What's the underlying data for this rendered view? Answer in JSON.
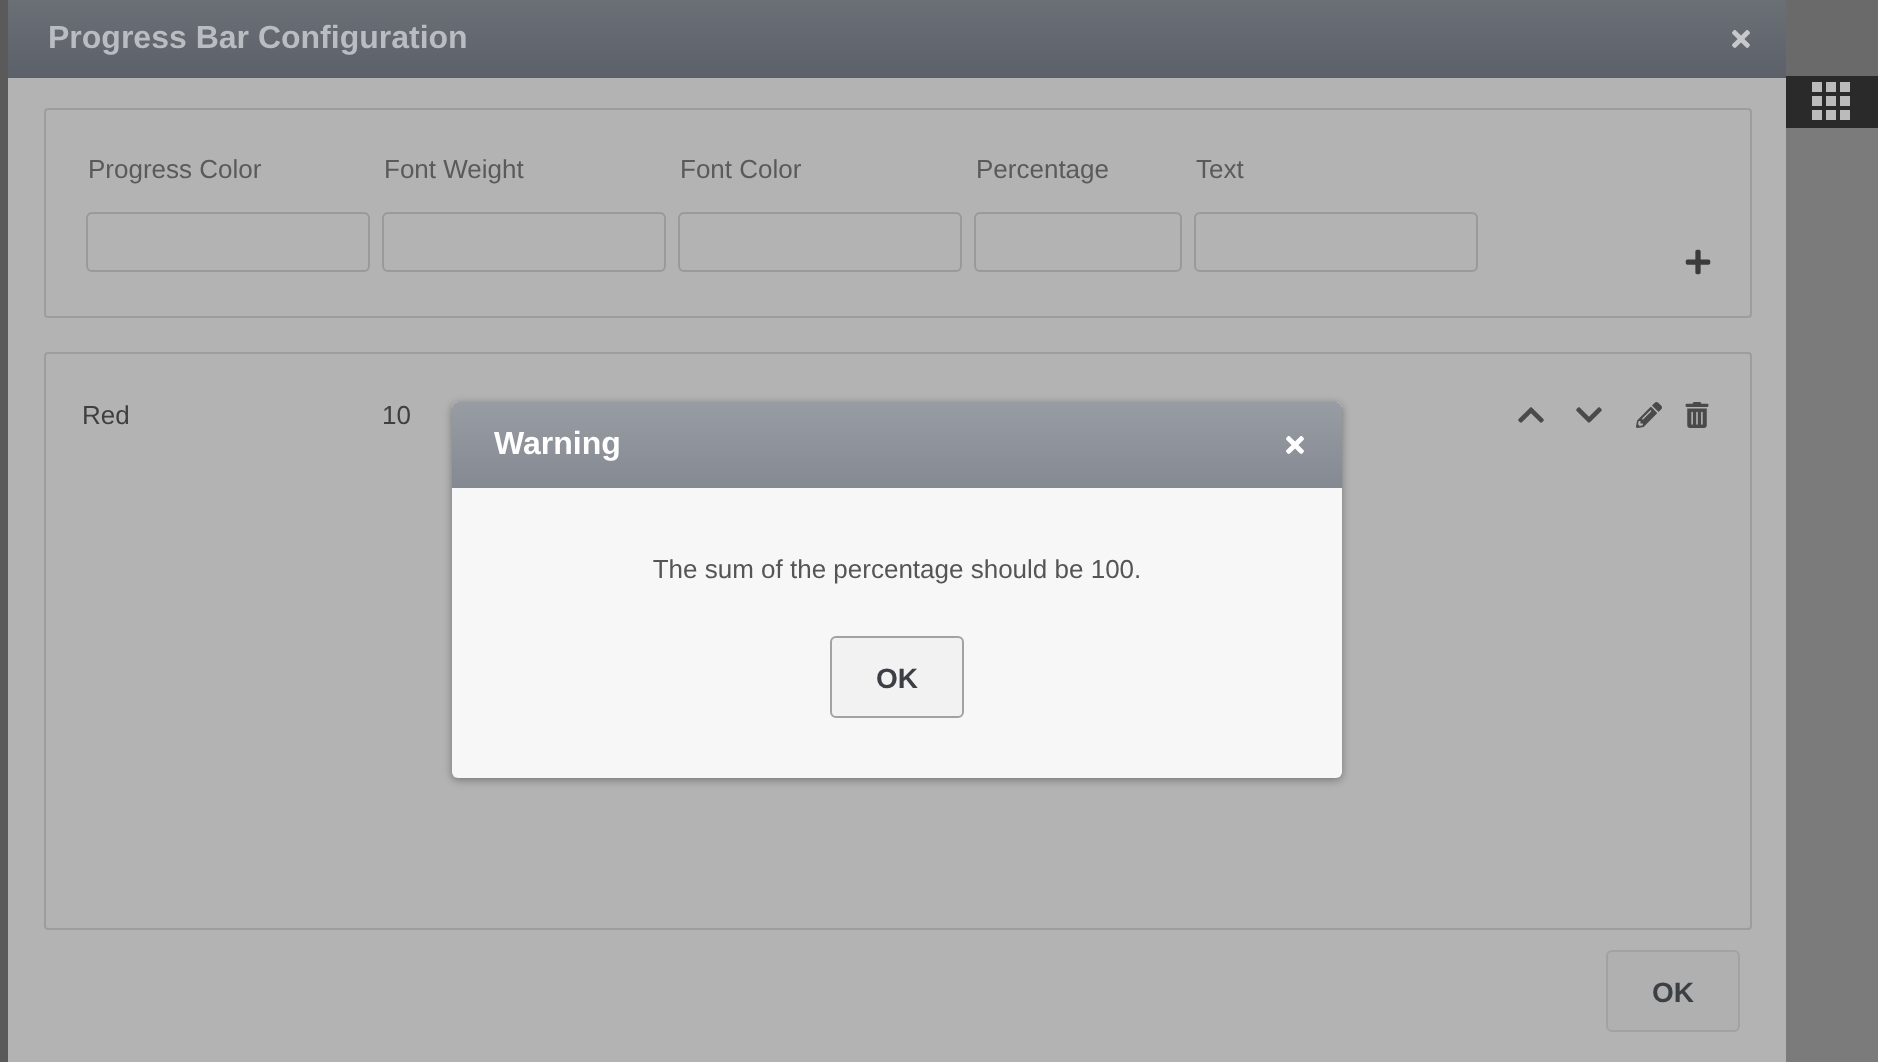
{
  "dialog": {
    "title": "Progress Bar Configuration",
    "columns": [
      {
        "label": "Progress Color"
      },
      {
        "label": "Font Weight"
      },
      {
        "label": "Font Color"
      },
      {
        "label": "Percentage"
      },
      {
        "label": "Text"
      }
    ],
    "rows": [
      {
        "cells": [
          "Red",
          "10"
        ]
      }
    ],
    "ok_button": "OK"
  },
  "warning": {
    "title": "Warning",
    "message": "The sum of the percentage should be 100.",
    "ok_button": "OK"
  }
}
